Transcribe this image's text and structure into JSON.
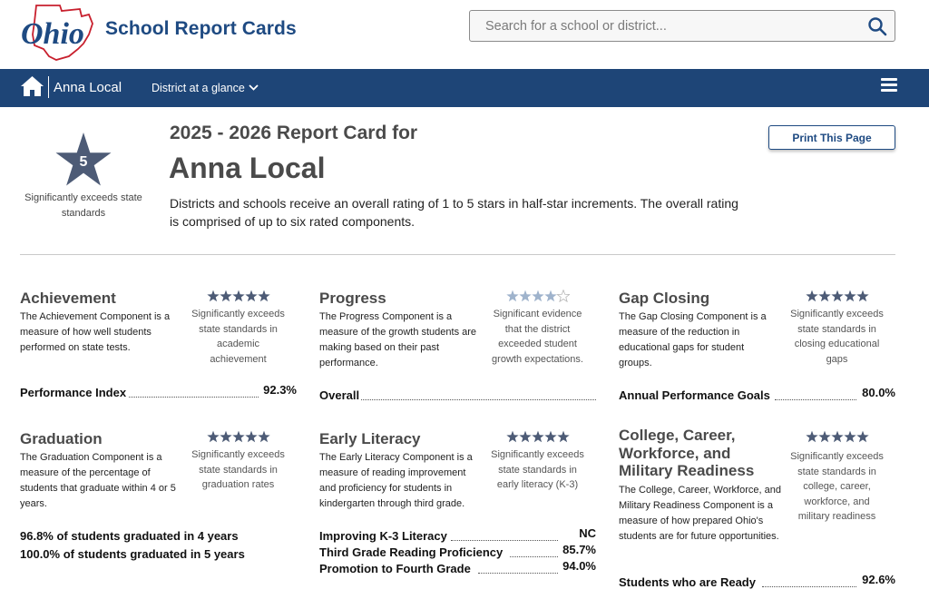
{
  "header": {
    "logo_text": "Ohio",
    "brand": "School Report Cards",
    "search_placeholder": "Search for a school or district..."
  },
  "nav": {
    "district": "Anna Local",
    "glance": "District at a glance"
  },
  "overview": {
    "overall_stars": "5",
    "overall_desc": "Significantly exceeds state standards",
    "year_title": "2025 - 2026 Report Card for",
    "district_title": "Anna Local",
    "intro": "Districts and schools receive an overall rating of 1 to 5 stars in half-star increments. The overall rating is comprised of up to six rated components.",
    "print_label": "Print This Page"
  },
  "colors": {
    "navy": "#1e4577",
    "star_dark": "#4d5b76",
    "star_light": "#9fb3cc"
  },
  "components": {
    "achievement": {
      "title": "Achievement",
      "stars": 5,
      "description": "The Achievement Component is a measure of how well students performed on state tests.",
      "rating": "Significantly exceeds state standards in academic achievement",
      "metric_label": "Performance Index",
      "metric_value": "92.3%"
    },
    "progress": {
      "title": "Progress",
      "stars": 4,
      "description": "The Progress Component is a measure of the growth students are making based on their past performance.",
      "rating": "Significant evidence that the district exceeded student growth expectations.",
      "metric_label": "Overall",
      "metric_value": ""
    },
    "gap_closing": {
      "title": "Gap Closing",
      "stars": 5,
      "description": "The Gap Closing Component is a measure of the reduction in educational gaps for student groups.",
      "rating": "Significantly exceeds state standards in closing educational gaps",
      "metric_label": "Annual Performance Goals",
      "metric_value": "80.0%"
    },
    "graduation": {
      "title": "Graduation",
      "stars": 5,
      "description": "The Graduation Component is a measure of the percentage of students that graduate within 4 or 5 years.",
      "rating": "Significantly exceeds state standards in graduation rates",
      "line1": "96.8% of students graduated in 4 years",
      "line2": "100.0% of students graduated in 5 years"
    },
    "early_literacy": {
      "title": "Early Literacy",
      "stars": 5,
      "description": "The Early Literacy Component is a measure of reading improvement and proficiency for students in kindergarten through third grade.",
      "rating": "Significantly exceeds state standards in early literacy (K-3)",
      "metrics": [
        {
          "label": "Improving K-3 Literacy",
          "value": "NC"
        },
        {
          "label": "Third Grade Reading Proficiency",
          "value": "85.7%"
        },
        {
          "label": "Promotion to Fourth Grade",
          "value": "94.0%"
        }
      ]
    },
    "ccwmr": {
      "title": "College, Career, Workforce, and Military Readiness",
      "stars": 5,
      "description": "The College, Career, Workforce, and Military Readiness Component is a measure of how prepared Ohio's students are for future opportunities.",
      "rating": "Significantly exceeds state standards in college, career, workforce, and military readiness",
      "metric_label": "Students who are Ready",
      "metric_value": "92.6%"
    }
  }
}
